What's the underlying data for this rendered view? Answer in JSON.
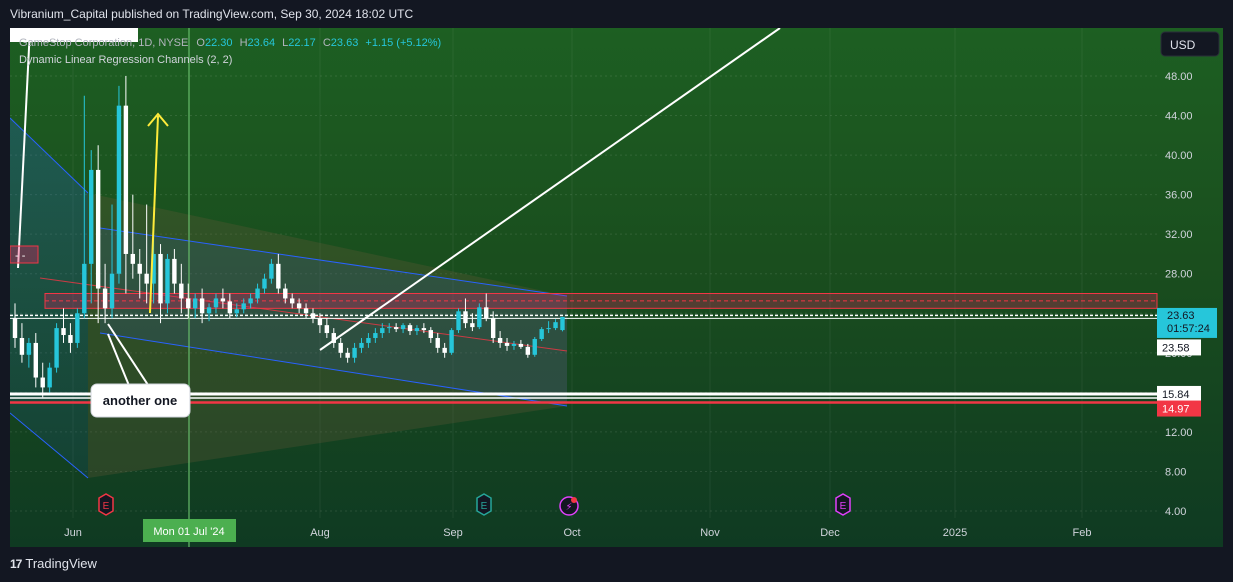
{
  "header": {
    "published": "Vibranium_Capital published on TradingView.com, Sep 30, 2024 18:02 UTC"
  },
  "footer": {
    "brand": "TradingView"
  },
  "legend": {
    "symbol": "GameStop Corporation, 1D, NYSE",
    "o_label": "O",
    "o_value": "22.30",
    "h_label": "H",
    "h_value": "23.64",
    "l_label": "L",
    "l_value": "22.17",
    "c_label": "C",
    "c_value": "23.63",
    "change": "+1.15 (+5.12%)",
    "indicator": "Dynamic Linear Regression Channels (2, 2)"
  },
  "currency_button": "USD",
  "annotations": {
    "callout": "another one",
    "earnings_marker": "E",
    "dividend_marker": "E",
    "event_marker": "⚡",
    "top_left_box": "- -"
  },
  "price_labels": {
    "last_price": "23.63",
    "countdown": "01:57:24",
    "regression_price": "23.58",
    "support_1": "15.84",
    "support_2": "14.97"
  },
  "crosshair_label": "Mon 01 Jul '24",
  "colors": {
    "bull": "#26c6da",
    "bear": "#ffffff",
    "support_red": "#f23645",
    "channel_blue": "#2962ff",
    "crosshair": "#66bb6a",
    "arrow_yellow": "#ffeb3b"
  },
  "chart_data": {
    "type": "candlestick",
    "y_ticks": [
      "48.00",
      "44.00",
      "40.00",
      "36.00",
      "32.00",
      "28.00",
      "24.00",
      "20.00",
      "16.00",
      "12.00",
      "8.00",
      "4.00"
    ],
    "ylim": [
      3,
      52
    ],
    "x_ticks": [
      "Jun",
      "Aug",
      "Sep",
      "Oct",
      "Nov",
      "Dec",
      "2025",
      "Feb"
    ],
    "candles": [
      [
        23.5,
        25,
        20.5,
        21.5
      ],
      [
        21.5,
        23,
        19,
        19.8
      ],
      [
        19.8,
        21.5,
        18.5,
        21
      ],
      [
        21,
        22,
        16.5,
        17.5
      ],
      [
        17.5,
        19,
        15.5,
        16.5
      ],
      [
        16.5,
        19,
        16,
        18.5
      ],
      [
        18.5,
        23,
        18,
        22.5
      ],
      [
        22.5,
        24.5,
        21,
        21.8
      ],
      [
        21.8,
        23,
        20,
        21
      ],
      [
        21,
        24.5,
        20.5,
        24
      ],
      [
        24,
        46,
        23.5,
        29
      ],
      [
        29,
        40.5,
        25,
        38.5
      ],
      [
        38.5,
        41,
        23,
        26.5
      ],
      [
        26.5,
        29,
        23,
        24.5
      ],
      [
        24.5,
        35,
        23.5,
        28
      ],
      [
        28,
        47,
        27,
        45
      ],
      [
        45,
        48,
        26,
        30
      ],
      [
        30,
        36,
        27.5,
        29
      ],
      [
        29,
        30.5,
        25.5,
        28
      ],
      [
        28,
        35,
        25,
        27
      ],
      [
        27,
        32.5,
        25,
        30
      ],
      [
        30,
        31,
        23,
        25
      ],
      [
        25,
        30,
        24,
        29.5
      ],
      [
        29.5,
        30.5,
        26,
        27
      ],
      [
        27,
        29,
        24,
        25.5
      ],
      [
        25.5,
        27,
        23.5,
        24.5
      ],
      [
        24.5,
        26,
        23.5,
        25.5
      ],
      [
        25.5,
        26.5,
        23,
        24
      ],
      [
        24,
        25,
        23.2,
        24.6
      ],
      [
        24.6,
        26,
        24,
        25.5
      ],
      [
        25.5,
        26.5,
        24.5,
        25.2
      ],
      [
        25.2,
        26,
        23.5,
        24
      ],
      [
        24,
        25,
        23.6,
        24.4
      ],
      [
        24.4,
        25.5,
        24,
        25
      ],
      [
        25,
        26,
        24.5,
        25.5
      ],
      [
        25.5,
        27,
        25,
        26.5
      ],
      [
        26.5,
        28,
        26,
        27.5
      ],
      [
        27.5,
        29.5,
        27,
        29
      ],
      [
        29,
        30,
        26,
        26.5
      ],
      [
        26.5,
        27,
        25,
        25.5
      ],
      [
        25.5,
        26,
        24.5,
        25
      ],
      [
        25,
        25.5,
        24,
        24.5
      ],
      [
        24.5,
        25,
        23.5,
        24
      ],
      [
        24,
        24.5,
        23,
        23.5
      ],
      [
        23.5,
        24,
        22,
        22.8
      ],
      [
        22.8,
        23.5,
        21.5,
        22
      ],
      [
        22,
        22.5,
        20.5,
        21
      ],
      [
        21,
        21.5,
        19.5,
        20
      ],
      [
        20,
        20.5,
        19,
        19.5
      ],
      [
        19.5,
        21,
        19,
        20.5
      ],
      [
        20.5,
        21.5,
        20,
        21
      ],
      [
        21,
        22,
        20.5,
        21.5
      ],
      [
        21.5,
        22.5,
        21,
        22
      ],
      [
        22,
        23,
        21.5,
        22.5
      ],
      [
        22.5,
        23,
        22,
        22.6
      ],
      [
        22.6,
        23,
        22.1,
        22.4
      ],
      [
        22.4,
        23,
        22,
        22.8
      ],
      [
        22.8,
        23,
        21.8,
        22.2
      ],
      [
        22.2,
        22.8,
        21.8,
        22.5
      ],
      [
        22.5,
        23,
        22,
        22.3
      ],
      [
        22.3,
        22.6,
        21,
        21.5
      ],
      [
        21.5,
        22,
        20,
        20.5
      ],
      [
        20.5,
        21,
        19.5,
        20
      ],
      [
        20,
        22.5,
        19.8,
        22.3
      ],
      [
        22.3,
        24.5,
        22,
        24.2
      ],
      [
        24.2,
        25.5,
        22.5,
        23
      ],
      [
        23,
        24,
        22.2,
        22.6
      ],
      [
        22.6,
        25,
        22.4,
        24.6
      ],
      [
        24.6,
        26,
        23.2,
        23.5
      ],
      [
        23.5,
        24.2,
        21,
        21.5
      ],
      [
        21.5,
        22.2,
        20.5,
        21
      ],
      [
        21,
        21.5,
        20.2,
        20.7
      ],
      [
        20.7,
        21.2,
        20.3,
        20.9
      ],
      [
        20.9,
        21.3,
        20.4,
        20.6
      ],
      [
        20.6,
        20.9,
        19.5,
        19.8
      ],
      [
        19.8,
        21.6,
        19.6,
        21.4
      ],
      [
        21.4,
        22.6,
        21.2,
        22.4
      ],
      [
        22.4,
        23.2,
        22,
        22.5
      ],
      [
        22.5,
        23.4,
        22.3,
        23.1
      ],
      [
        22.3,
        23.64,
        22.17,
        23.63
      ]
    ],
    "lines": {
      "price_line": 23.63,
      "regression_price": 23.58,
      "support_1": 15.84,
      "support_2": 14.97,
      "resistance_zone": [
        24.5,
        26
      ]
    }
  }
}
